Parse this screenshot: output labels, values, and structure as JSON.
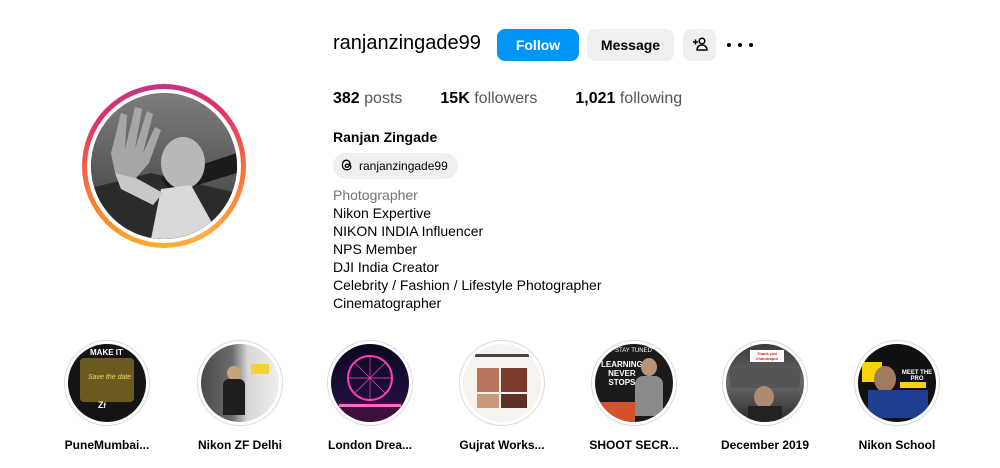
{
  "profile": {
    "username": "ranjanzingade99",
    "full_name": "Ranjan Zingade",
    "threads_handle": "ranjanzingade99",
    "avatar_icon": "profile-photo"
  },
  "actions": {
    "follow_label": "Follow",
    "message_label": "Message",
    "add_user_icon": "person-add-icon",
    "more_icon": "more-options-icon"
  },
  "stats": {
    "posts_count": "382",
    "posts_label": "posts",
    "followers_count": "15K",
    "followers_label": "followers",
    "following_count": "1,021",
    "following_label": "following"
  },
  "bio": {
    "category": "Photographer",
    "lines": [
      "Nikon Expertive",
      "NIKON INDIA Influencer",
      "NPS Member",
      "DJI India Creator",
      "Celebrity / Fashion / Lifestyle Photographer",
      "Cinematographer"
    ]
  },
  "highlights": [
    {
      "label": "PuneMumbai..."
    },
    {
      "label": "Nikon ZF Delhi"
    },
    {
      "label": "London Drea..."
    },
    {
      "label": "Gujrat Works..."
    },
    {
      "label": "SHOOT SECR..."
    },
    {
      "label": "December 2019"
    },
    {
      "label": "Nikon School"
    }
  ],
  "highlight_texts": {
    "make_it": "MAKE IT",
    "save_date": "Save the date",
    "stay_tuned": "STAY TUNED",
    "learning": "LEARNING",
    "never": "NEVER",
    "stops": "STOPS",
    "thank_you": "Thank you Chandrapur",
    "meet_the_pro": "MEET THE PRO"
  },
  "colors": {
    "follow_blue": "#0095f6",
    "button_gray": "#efefef",
    "muted_text": "#737373"
  }
}
